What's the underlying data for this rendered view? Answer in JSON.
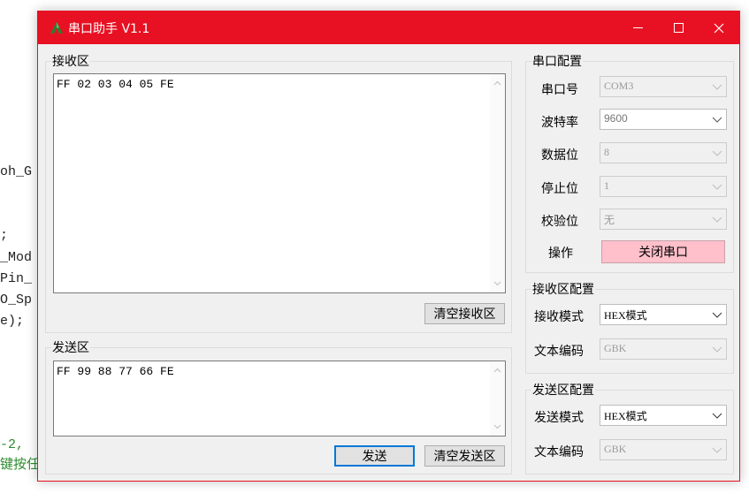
{
  "background_code": {
    "lines": [
      "oh_G",
      ";",
      "_Mod",
      "Pin_",
      "O_Sp",
      "e);",
      "-2,",
      "键按任"
    ]
  },
  "window": {
    "title": "串口助手 V1.1",
    "accent_color": "#e81123",
    "controls": {
      "minimize_icon": "minimize-icon",
      "maximize_icon": "maximize-icon",
      "close_icon": "close-icon"
    }
  },
  "receive": {
    "group_label": "接收区",
    "content": "FF 02 03 04 05 FE",
    "clear_button": "清空接收区"
  },
  "send": {
    "group_label": "发送区",
    "content": "FF 99 88 77 66 FE",
    "send_button": "发送",
    "clear_button": "清空发送区"
  },
  "serial_config": {
    "group_label": "串口配置",
    "port_label": "串口号",
    "port_value": "COM3",
    "baud_label": "波特率",
    "baud_value": "9600",
    "databits_label": "数据位",
    "databits_value": "8",
    "stopbits_label": "停止位",
    "stopbits_value": "1",
    "parity_label": "校验位",
    "parity_value": "无",
    "action_label": "操作",
    "action_button": "关闭串口"
  },
  "receive_config": {
    "group_label": "接收区配置",
    "mode_label": "接收模式",
    "mode_value": "HEX模式",
    "encoding_label": "文本编码",
    "encoding_value": "GBK"
  },
  "send_config": {
    "group_label": "发送区配置",
    "mode_label": "发送模式",
    "mode_value": "HEX模式",
    "encoding_label": "文本编码",
    "encoding_value": "GBK"
  }
}
